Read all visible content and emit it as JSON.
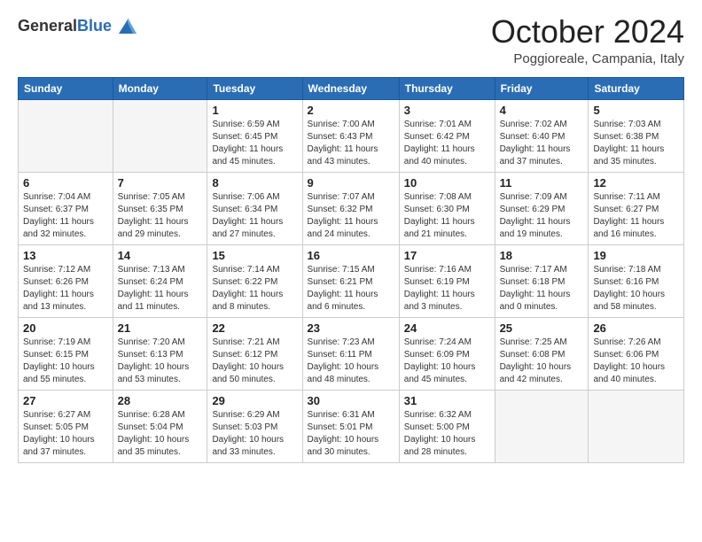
{
  "header": {
    "logo_general": "General",
    "logo_blue": "Blue",
    "month_title": "October 2024",
    "location": "Poggioreale, Campania, Italy"
  },
  "days_of_week": [
    "Sunday",
    "Monday",
    "Tuesday",
    "Wednesday",
    "Thursday",
    "Friday",
    "Saturday"
  ],
  "weeks": [
    [
      {
        "day": "",
        "info": ""
      },
      {
        "day": "",
        "info": ""
      },
      {
        "day": "1",
        "info": "Sunrise: 6:59 AM\nSunset: 6:45 PM\nDaylight: 11 hours and 45 minutes."
      },
      {
        "day": "2",
        "info": "Sunrise: 7:00 AM\nSunset: 6:43 PM\nDaylight: 11 hours and 43 minutes."
      },
      {
        "day": "3",
        "info": "Sunrise: 7:01 AM\nSunset: 6:42 PM\nDaylight: 11 hours and 40 minutes."
      },
      {
        "day": "4",
        "info": "Sunrise: 7:02 AM\nSunset: 6:40 PM\nDaylight: 11 hours and 37 minutes."
      },
      {
        "day": "5",
        "info": "Sunrise: 7:03 AM\nSunset: 6:38 PM\nDaylight: 11 hours and 35 minutes."
      }
    ],
    [
      {
        "day": "6",
        "info": "Sunrise: 7:04 AM\nSunset: 6:37 PM\nDaylight: 11 hours and 32 minutes."
      },
      {
        "day": "7",
        "info": "Sunrise: 7:05 AM\nSunset: 6:35 PM\nDaylight: 11 hours and 29 minutes."
      },
      {
        "day": "8",
        "info": "Sunrise: 7:06 AM\nSunset: 6:34 PM\nDaylight: 11 hours and 27 minutes."
      },
      {
        "day": "9",
        "info": "Sunrise: 7:07 AM\nSunset: 6:32 PM\nDaylight: 11 hours and 24 minutes."
      },
      {
        "day": "10",
        "info": "Sunrise: 7:08 AM\nSunset: 6:30 PM\nDaylight: 11 hours and 21 minutes."
      },
      {
        "day": "11",
        "info": "Sunrise: 7:09 AM\nSunset: 6:29 PM\nDaylight: 11 hours and 19 minutes."
      },
      {
        "day": "12",
        "info": "Sunrise: 7:11 AM\nSunset: 6:27 PM\nDaylight: 11 hours and 16 minutes."
      }
    ],
    [
      {
        "day": "13",
        "info": "Sunrise: 7:12 AM\nSunset: 6:26 PM\nDaylight: 11 hours and 13 minutes."
      },
      {
        "day": "14",
        "info": "Sunrise: 7:13 AM\nSunset: 6:24 PM\nDaylight: 11 hours and 11 minutes."
      },
      {
        "day": "15",
        "info": "Sunrise: 7:14 AM\nSunset: 6:22 PM\nDaylight: 11 hours and 8 minutes."
      },
      {
        "day": "16",
        "info": "Sunrise: 7:15 AM\nSunset: 6:21 PM\nDaylight: 11 hours and 6 minutes."
      },
      {
        "day": "17",
        "info": "Sunrise: 7:16 AM\nSunset: 6:19 PM\nDaylight: 11 hours and 3 minutes."
      },
      {
        "day": "18",
        "info": "Sunrise: 7:17 AM\nSunset: 6:18 PM\nDaylight: 11 hours and 0 minutes."
      },
      {
        "day": "19",
        "info": "Sunrise: 7:18 AM\nSunset: 6:16 PM\nDaylight: 10 hours and 58 minutes."
      }
    ],
    [
      {
        "day": "20",
        "info": "Sunrise: 7:19 AM\nSunset: 6:15 PM\nDaylight: 10 hours and 55 minutes."
      },
      {
        "day": "21",
        "info": "Sunrise: 7:20 AM\nSunset: 6:13 PM\nDaylight: 10 hours and 53 minutes."
      },
      {
        "day": "22",
        "info": "Sunrise: 7:21 AM\nSunset: 6:12 PM\nDaylight: 10 hours and 50 minutes."
      },
      {
        "day": "23",
        "info": "Sunrise: 7:23 AM\nSunset: 6:11 PM\nDaylight: 10 hours and 48 minutes."
      },
      {
        "day": "24",
        "info": "Sunrise: 7:24 AM\nSunset: 6:09 PM\nDaylight: 10 hours and 45 minutes."
      },
      {
        "day": "25",
        "info": "Sunrise: 7:25 AM\nSunset: 6:08 PM\nDaylight: 10 hours and 42 minutes."
      },
      {
        "day": "26",
        "info": "Sunrise: 7:26 AM\nSunset: 6:06 PM\nDaylight: 10 hours and 40 minutes."
      }
    ],
    [
      {
        "day": "27",
        "info": "Sunrise: 6:27 AM\nSunset: 5:05 PM\nDaylight: 10 hours and 37 minutes."
      },
      {
        "day": "28",
        "info": "Sunrise: 6:28 AM\nSunset: 5:04 PM\nDaylight: 10 hours and 35 minutes."
      },
      {
        "day": "29",
        "info": "Sunrise: 6:29 AM\nSunset: 5:03 PM\nDaylight: 10 hours and 33 minutes."
      },
      {
        "day": "30",
        "info": "Sunrise: 6:31 AM\nSunset: 5:01 PM\nDaylight: 10 hours and 30 minutes."
      },
      {
        "day": "31",
        "info": "Sunrise: 6:32 AM\nSunset: 5:00 PM\nDaylight: 10 hours and 28 minutes."
      },
      {
        "day": "",
        "info": ""
      },
      {
        "day": "",
        "info": ""
      }
    ]
  ]
}
